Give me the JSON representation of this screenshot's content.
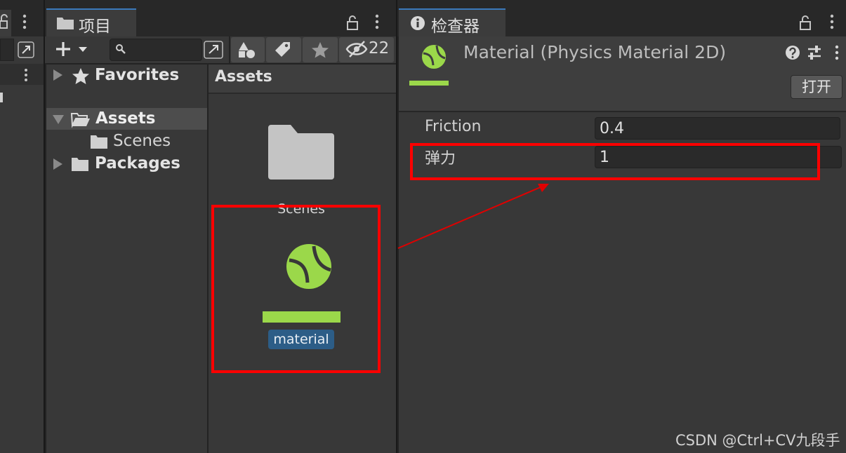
{
  "project": {
    "tab_label": "项目",
    "hidden_count": "22",
    "tree": {
      "favorites": "Favorites",
      "assets": "Assets",
      "scenes": "Scenes",
      "packages": "Packages"
    },
    "content": {
      "breadcrumb": "Assets",
      "folder_label": "Scenes",
      "material_label": "material"
    }
  },
  "inspector": {
    "tab_label": "检查器",
    "title": "Material (Physics Material 2D)",
    "open_button": "打开",
    "fields": [
      {
        "label": "Friction",
        "value": "0.4"
      },
      {
        "label": "弹力",
        "value": "1"
      }
    ]
  },
  "watermark": "CSDN @Ctrl+CV九段手",
  "colors": {
    "accent_green": "#9bd84a",
    "highlight_red": "#ff0000",
    "selection_blue": "#2c5d87"
  }
}
